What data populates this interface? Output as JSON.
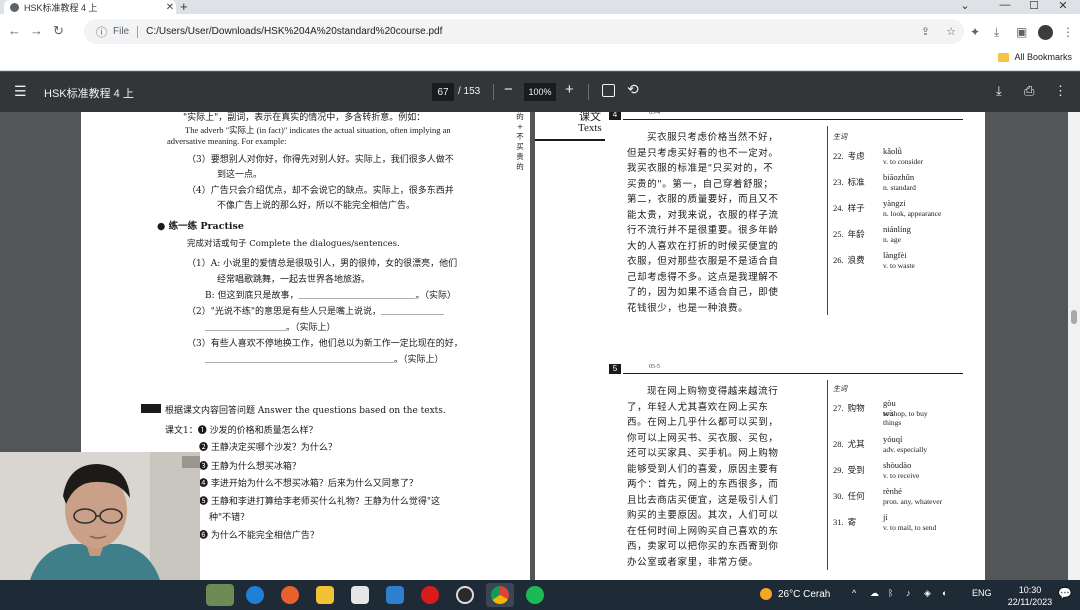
{
  "browser": {
    "tab_title": "HSK标准教程 4 上",
    "tab_close": "✕",
    "new_tab": "+",
    "window_controls": [
      "⌄",
      "—",
      "☐",
      "✕"
    ],
    "nav": {
      "back": "←",
      "forward": "→",
      "reload": "↻"
    },
    "address": {
      "scheme_label": "File",
      "url": "C:/Users/User/Downloads/HSK%204A%20standard%20course.pdf"
    },
    "bookmarks": {
      "all_label": "All Bookmarks"
    }
  },
  "pdf_toolbar": {
    "menu_icon": "☰",
    "title": "HSK标准教程 4 上",
    "current_page": "67",
    "total_pages": "/ 153",
    "zoom": "100%",
    "zoom_out": "−",
    "zoom_in": "+",
    "rotate": "⟲",
    "download": "⤓",
    "print": "⎙",
    "more": "⋮"
  },
  "left_page": {
    "lines": [
      "\"实际上\"，副词，表示在真实的情况中，多含转折意。例如：",
      "The adverb \"实际上 (in fact)\" indicates the actual situation, often implying an",
      "adversative meaning. For example:",
      "（3）要想别人对你好，你得先对别人好。实际上，我们很多人做不",
      "到这一点。",
      "（4）广告只会介绍优点，却不会说它的缺点。实际上，很多东西并",
      "不像广告上说的那么好，所以不能完全相信广告。",
      "● 练一练  Practise",
      "完成对话或句子  Complete the dialogues/sentences.",
      "（1）A: 小说里的爱情总是很吸引人，男的很帅，女的很漂亮，他们",
      "经常唱歌跳舞，一起去世界各地旅游。",
      "B: 但这到底只是故事，＿＿＿＿＿＿＿＿＿＿＿＿＿。（实际）",
      "（2）\"光说不练\"的意思是有些人只是嘴上说说，＿＿＿＿＿＿＿",
      "＿＿＿＿＿＿＿＿＿。（实际上）",
      "（3）有些人喜欢不停地换工作，他们总以为新工作一定比现在的好，",
      "＿＿＿＿＿＿＿＿＿＿＿＿＿＿＿＿＿＿＿＿＿。（实际上）",
      "根据课文内容回答问题   Answer the questions based on the texts.",
      "课文1：❶ 沙发的价格和质量怎么样？",
      "❷ 王静决定买哪个沙发？为什么？",
      "❸ 王静为什么想买冰箱？",
      "❹ 李进开始为什么不想买冰箱？后来为什么又同意了？",
      "❺ 王静和李进打算给李老师买什么礼物？王静为什么觉得\"这",
      "种\"不错？",
      "❻ 为什么不能完全相信广告？"
    ],
    "margin_note": [
      "的",
      "+",
      "不",
      "买",
      "贵",
      "的"
    ]
  },
  "right_page": {
    "header_label": "课文",
    "header_label_en": "Texts",
    "section4": {
      "number": "4",
      "code": "05-4",
      "text": [
        "买衣服只考虑价格当然不好，",
        "但是只考虑买好看的也不一定对。",
        "我买衣服的标准是\"只买对的，不",
        "买贵的\"。第一，自己穿着舒服；",
        "第二，衣服的质量要好，而且又不",
        "能太贵，对我来说，衣服的样子流",
        "行不流行并不是很重要。很多年龄",
        "大的人喜欢在打折的时候买便宜的",
        "衣服，但对那些衣服是不是适合自",
        "己却考虑得不多。这点是我理解不",
        "了的，因为如果不适合自己，即使",
        "花钱很少，也是一种浪费。"
      ],
      "vocab_title": "生词",
      "vocab": [
        {
          "num": "22.",
          "hanzi": "考虑",
          "pinyin": "kǎolǜ",
          "def": "v. to consider"
        },
        {
          "num": "23.",
          "hanzi": "标准",
          "pinyin": "biāozhǔn",
          "def": "n. standard"
        },
        {
          "num": "24.",
          "hanzi": "样子",
          "pinyin": "yàngzi",
          "def": "n. look, appearance"
        },
        {
          "num": "25.",
          "hanzi": "年龄",
          "pinyin": "niánlíng",
          "def": "n. age"
        },
        {
          "num": "26.",
          "hanzi": "浪费",
          "pinyin": "làngfèi",
          "def": "v. to waste"
        }
      ]
    },
    "section5": {
      "number": "5",
      "code": "05-5",
      "text": [
        "现在网上购物变得越来越流行",
        "了，年轻人尤其喜欢在网上买东",
        "西。在网上几乎什么都可以买到，",
        "你可以上网买书、买衣服、买包，",
        "还可以买家具、买手机。网上购物",
        "能够受到人们的喜爱，原因主要有",
        "两个：首先，网上的东西很多，而",
        "且比去商店买便宜，这是吸引人们",
        "购买的主要原因。其次，人们可以",
        "在任何时间上网购买自己喜欢的东",
        "西，卖家可以把你买的东西寄到你",
        "办公室或者家里，非常方便。"
      ],
      "vocab_title": "生词",
      "vocab": [
        {
          "num": "27.",
          "hanzi": "购物",
          "pinyin": "gòu wù",
          "def": "to shop, to buy things"
        },
        {
          "num": "28.",
          "hanzi": "尤其",
          "pinyin": "yóuqí",
          "def": "adv. especially"
        },
        {
          "num": "29.",
          "hanzi": "受到",
          "pinyin": "shòudào",
          "def": "v. to receive"
        },
        {
          "num": "30.",
          "hanzi": "任何",
          "pinyin": "rènhé",
          "def": "pron. any, whatever"
        },
        {
          "num": "31.",
          "hanzi": "寄",
          "pinyin": "jì",
          "def": "v. to mail, to send"
        }
      ]
    }
  },
  "taskbar": {
    "weather": "26°C Cerah",
    "tray_expand": "^",
    "lang": "ENG",
    "time": "10:30",
    "date": "22/11/2023",
    "notification": "💬"
  },
  "colors": {
    "pdf_toolbar": "#323639",
    "viewer_bg": "#525659",
    "taskbar": "#1e2a36"
  }
}
